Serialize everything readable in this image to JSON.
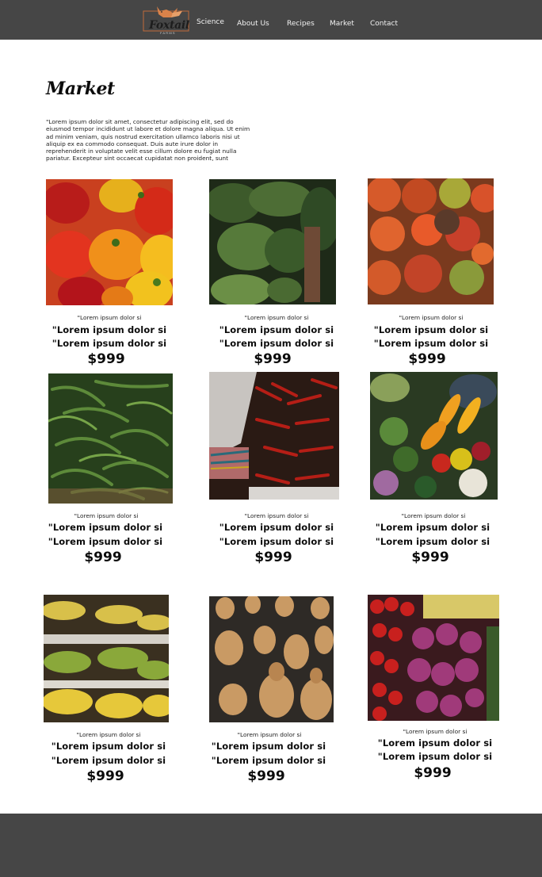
{
  "brand": {
    "name": "Foxtail",
    "tagline": "FARMS"
  },
  "nav": [
    {
      "label": "Science"
    },
    {
      "label": "About Us"
    },
    {
      "label": "Recipes"
    },
    {
      "label": "Market"
    },
    {
      "label": "Contact"
    }
  ],
  "page": {
    "title": "Market",
    "intro": "\"Lorem ipsum dolor sit amet, consectetur adipiscing elit, sed do eiusmod tempor incididunt ut labore et dolore magna aliqua. Ut enim ad minim veniam, quis nostrud exercitation ullamco laboris nisi ut aliquip ex ea commodo consequat. Duis aute irure dolor in reprehenderit in voluptate velit esse cillum dolore eu fugiat nulla pariatur. Excepteur sint occaecat cupidatat non proident, sunt"
  },
  "products": [
    {
      "image": "bell-peppers-photo",
      "small": "\"Lorem ipsum dolor si",
      "line1": "\"Lorem ipsum dolor si",
      "line2": "\"Lorem ipsum dolor si",
      "price": "$999"
    },
    {
      "image": "leafy-greens-photo",
      "small": "\"Lorem ipsum dolor si",
      "line1": "\"Lorem ipsum dolor si",
      "line2": "\"Lorem ipsum dolor si",
      "price": "$999"
    },
    {
      "image": "tomatoes-photo",
      "small": "\"Lorem ipsum dolor si",
      "line1": "\"Lorem ipsum dolor si",
      "line2": "\"Lorem ipsum dolor si",
      "price": "$999"
    },
    {
      "image": "green-beans-photo",
      "small": "\"Lorem ipsum dolor si",
      "line1": "\"Lorem ipsum dolor si",
      "line2": "\"Lorem ipsum dolor si",
      "price": "$999"
    },
    {
      "image": "chili-peppers-photo",
      "small": "\"Lorem ipsum dolor si",
      "line1": "\"Lorem ipsum dolor si",
      "line2": "\"Lorem ipsum dolor si",
      "price": "$999"
    },
    {
      "image": "mixed-vegetables-photo",
      "small": "\"Lorem ipsum dolor si",
      "line1": "\"Lorem ipsum dolor si",
      "line2": "\"Lorem ipsum dolor si",
      "price": "$999"
    },
    {
      "image": "bananas-photo",
      "small": "\"Lorem ipsum dolor si",
      "line1": "\"Lorem ipsum dolor si",
      "line2": "\"Lorem ipsum dolor si",
      "price": "$999"
    },
    {
      "image": "butternut-squash-photo",
      "small": "\"Lorem ipsum dolor si",
      "line1": "\"Lorem ipsum dolor si",
      "line2": "\"Lorem ipsum dolor si",
      "price": "$999"
    },
    {
      "image": "radishes-onions-photo",
      "small": "\"Lorem ipsum dolor si",
      "line1": "\"Lorem ipsum dolor si",
      "line2": "\"Lorem ipsum dolor si",
      "price": "$999"
    }
  ],
  "colors": {
    "header": "#464646",
    "footer": "#464646",
    "background": "#ffffff",
    "text": "#0c0c0c"
  }
}
